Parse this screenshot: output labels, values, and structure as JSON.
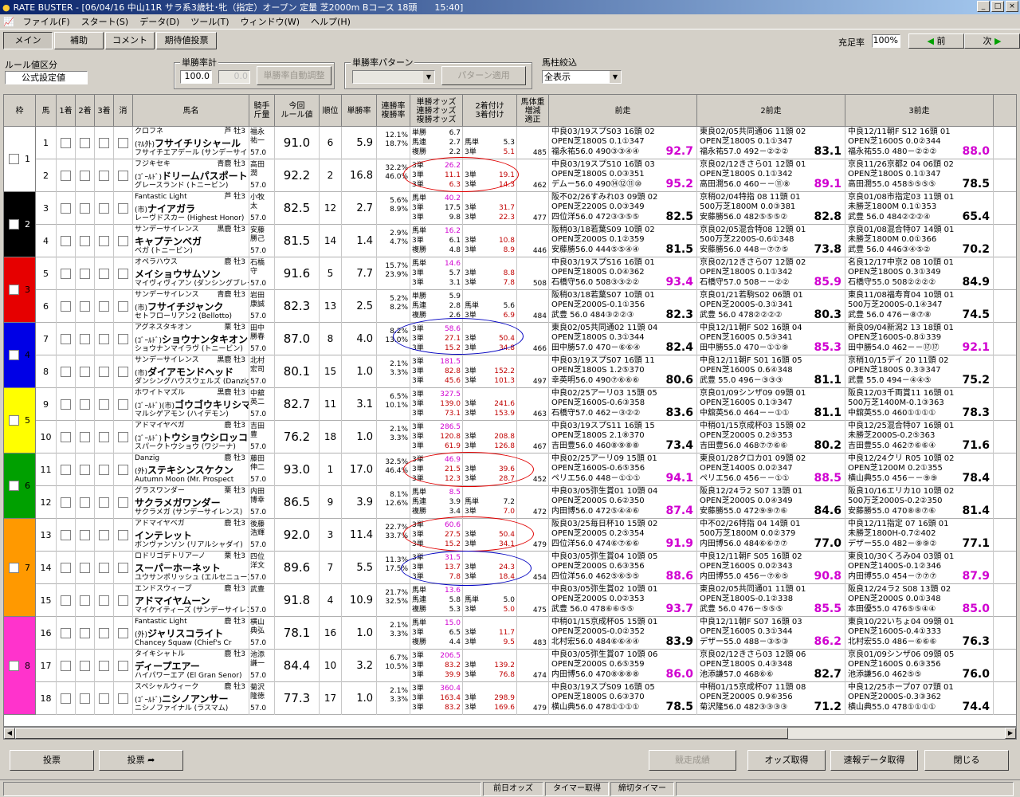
{
  "window": {
    "title": "RATE BUSTER - [06/04/16 中山11R サラ系3歳牡･牝（指定）オープン 定量 芝2000m Bコース 18頭　　15:40]"
  },
  "menu": [
    "ファイル(F)",
    "スタート(S)",
    "データ(D)",
    "ツール(T)",
    "ウィンドウ(W)",
    "ヘルプ(H)"
  ],
  "tabs": [
    "メイン",
    "補助",
    "コメント",
    "期待値投票"
  ],
  "fill_rate": {
    "label": "充足率",
    "value": "100%"
  },
  "nav": {
    "prev": "前",
    "next": "次"
  },
  "rule": {
    "label": "ルール値区分",
    "value": "公式設定値"
  },
  "win_rate": {
    "label": "単勝率計",
    "value1": "100.0",
    "value2": "0.0",
    "button": "単勝率自動調整"
  },
  "pattern": {
    "label": "単勝率パターン",
    "button": "パターン適用"
  },
  "filter": {
    "label": "馬柱絞込",
    "value": "全表示"
  },
  "headers": {
    "waku": "枠",
    "uma": "馬",
    "p1": "1着",
    "p2": "2着",
    "p3": "3着",
    "scratch": "消",
    "name": "馬名",
    "jockey": "騎手\n斤量",
    "rule_val": "今回\nルール値",
    "rank": "順位",
    "win": "単勝率",
    "ren": "連勝率\n複勝率",
    "odds": "単勝オッズ\n連勝オッズ\n複勝オッズ",
    "place2": "2着付け\n3着付け",
    "weight": "馬体重\n増減\n適正",
    "prev1": "前走",
    "prev2": "2前走",
    "prev3": "3前走"
  },
  "colors": {
    "waku": [
      "#ffffff",
      "#000000",
      "#e60000",
      "#0000e6",
      "#ffff00",
      "#00a000",
      "#ff9900",
      "#ff33cc"
    ]
  },
  "horses": [
    {
      "num": "1",
      "sire": "クロフネ",
      "tag": "芦 牡3",
      "pre": "(ﾏﾙ外)",
      "name": "フサイチリシャール",
      "dam": "フサイチエアデール (サンデーサイレンス)",
      "jockey": "福永\n祐一",
      "kg": "57.0",
      "rv": "91.0",
      "rank": "6",
      "win": "5.9",
      "ren": "12.1%\n18.7%",
      "o1": "単勝",
      "v1": "6.7",
      "o2": "馬連",
      "v2": "2.7",
      "o3": "複勝",
      "v3": "2.2",
      "p2": "",
      "q2": "",
      "p3": "馬単",
      "q3": "5.3",
      "p4": "3単",
      "q4": "5.1",
      "wt": "485",
      "r1": "中良03/19スプS03 16頭 02",
      "r1b": "OPEN芝1800S 0.1①347",
      "r1c": "福永祐56.0 490③③④④",
      "r1s": "92.7",
      "r2": "東良02/05共同通06 11頭 02",
      "r2b": "OPEN芝1800S 0.1①347",
      "r2c": "福永祐57.0 492－②②②",
      "r2s": "83.1",
      "r3": "中良12/11朝F S12 16頭 01",
      "r3b": "OPEN芝1600S 0.0②344",
      "r3c": "福永祐55.0 480－②②②",
      "r3s": "88.0"
    },
    {
      "num": "2",
      "sire": "フジキセキ",
      "tag": "青鹿 牡3",
      "pre": "(ｺﾞｰﾙﾄﾞ)",
      "name": "ドリームパスポート",
      "dam": "グレースランド (トニービン)",
      "jockey": "高田\n潤",
      "kg": "57.0",
      "rv": "92.2",
      "rank": "2",
      "win": "16.8",
      "ren": "32.2%\n46.0%",
      "o1": "3単",
      "v1": "26.2",
      "o2": "3単",
      "v2": "11.1",
      "o3": "3単",
      "v3": "6.3",
      "p2": "",
      "q2": "",
      "p3": "3単",
      "q3": "19.1",
      "p4": "3単",
      "q4": "14.3",
      "wt": "462",
      "r1": "中良03/19スプS10 16頭 03",
      "r1b": "OPEN芝1800S 0.0③351",
      "r1c": "デムー56.0 490⑭⑫⑪⑩",
      "r1s": "95.2",
      "r2": "京良02/12きさら01 12頭 01",
      "r2b": "OPEN芝1800S 0.1①342",
      "r2c": "高田潤56.0 460－－⑪⑧",
      "r2s": "89.1",
      "r3": "京良11/26京都2 04 06頭 02",
      "r3b": "OPEN芝1800S 0.1①347",
      "r3c": "高田潤55.0 458⑤⑤⑤⑤",
      "r3s": "78.5"
    },
    {
      "num": "3",
      "sire": "Fantastic Light",
      "tag": "芦 牡3",
      "pre": "(市)",
      "name": "ナイアガラ",
      "dam": "レーヴドスカー (Highest Honor)",
      "jockey": "小牧\n太",
      "kg": "57.0",
      "rv": "82.5",
      "rank": "12",
      "win": "2.7",
      "ren": "5.6%\n8.9%",
      "o1": "馬単",
      "v1": "40.2",
      "o2": "3単",
      "v2": "17.5",
      "o3": "3単",
      "v3": "9.8",
      "p2": "",
      "q2": "",
      "p3": "3単",
      "q3": "31.7",
      "p4": "3単",
      "q4": "22.3",
      "wt": "477",
      "r1": "阪不02/26すみれ03 09頭 02",
      "r1b": "OPEN芝2200S 0.0③349",
      "r1c": "四位洋56.0 472③③⑤⑤",
      "r1s": "82.5",
      "r2": "京稍02/04特指 08 11頭 01",
      "r2b": "500万芝1800M 0.0③381",
      "r2c": "安藤勝56.0 482⑤⑤⑤②",
      "r2s": "82.8",
      "r3": "京良01/08市指定03 11頭 01",
      "r3b": "未勝芝1800M 0.1①353",
      "r3c": "武豊 56.0 484②②②④",
      "r3s": "65.4"
    },
    {
      "num": "4",
      "sire": "サンデーサイレンス",
      "tag": "黒鹿 牡3",
      "pre": "",
      "name": "キャプテンベガ",
      "dam": "ベガ (トニービン)",
      "jockey": "安藤\n勝己",
      "kg": "57.0",
      "rv": "81.5",
      "rank": "14",
      "win": "1.4",
      "ren": "2.9%\n4.7%",
      "o1": "馬単",
      "v1": "16.2",
      "o2": "3単",
      "v2": "6.1",
      "o3": "複勝",
      "v3": "4.8",
      "p2": "",
      "q2": "",
      "p3": "3単",
      "q3": "10.8",
      "p4": "3単",
      "q4": "8.9",
      "wt": "446",
      "r1": "阪稍03/18若葉S09 10頭 02",
      "r1b": "OPEN芝2000S 0.1②359",
      "r1c": "安藤勝56.0 444⑤⑤④④",
      "r1s": "81.5",
      "r2": "京良02/05混合特08 12頭 01",
      "r2b": "500万芝2200S-0.6①348",
      "r2c": "安藤勝56.0 448－⑦⑦⑤",
      "r2s": "73.8",
      "r3": "京良01/08混合特07 14頭 01",
      "r3b": "未勝芝1800M 0.0①366",
      "r3c": "武豊 56.0 446③④⑤②",
      "r3s": "70.2"
    },
    {
      "num": "5",
      "sire": "オペラハウス",
      "tag": "鹿 牡3",
      "pre": "",
      "name": "メイショウサムソン",
      "dam": "マイヴィヴィアン (ダンシングブレーヴ)",
      "jockey": "石橋\n守",
      "kg": "57.0",
      "rv": "91.6",
      "rank": "5",
      "win": "7.7",
      "ren": "15.7%\n23.9%",
      "o1": "馬単",
      "v1": "14.6",
      "o2": "3単",
      "v2": "5.7",
      "o3": "3単",
      "v3": "3.1",
      "p2": "",
      "q2": "",
      "p3": "3単",
      "q3": "8.8",
      "p4": "3単",
      "q4": "7.8",
      "wt": "508",
      "r1": "中良03/19スプS16 16頭 01",
      "r1b": "OPEN芝1800S 0.0④362",
      "r1c": "石橋守56.0 508③③②②",
      "r1s": "93.4",
      "r2": "京良02/12きさら07 12頭 02",
      "r2b": "OPEN芝1800S 0.1①342",
      "r2c": "石橋守57.0 508－－②②",
      "r2s": "85.9",
      "r3": "名良12/17中京2 08 10頭 01",
      "r3b": "OPEN芝1800S 0.3①349",
      "r3c": "石橋守55.0 508②②②②",
      "r3s": "84.9"
    },
    {
      "num": "6",
      "sire": "サンデーサイレンス",
      "tag": "青鹿 牡3",
      "pre": "(市)",
      "name": "フサイチジャンク",
      "dam": "セトフローリアン2 (Bellotto)",
      "jockey": "岩田\n康誠",
      "kg": "57.0",
      "rv": "82.3",
      "rank": "13",
      "win": "2.5",
      "ren": "5.2%\n8.2%",
      "o1": "単勝",
      "v1": "5.9",
      "o2": "馬連",
      "v2": "2.8",
      "o3": "複勝",
      "v3": "2.6",
      "p2": "",
      "q2": "",
      "p3": "馬単",
      "q3": "5.6",
      "p4": "3単",
      "q4": "6.9",
      "wt": "484",
      "r1": "阪稍03/18若葉S07 10頭 01",
      "r1b": "OPEN芝2000S-0.1①356",
      "r1c": "武豊 56.0 484③②②③",
      "r1s": "82.3",
      "r2": "京良01/21若駒S02 06頭 01",
      "r2b": "OPEN芝2000S-0.3①341",
      "r2c": "武豊 56.0 478②②②②",
      "r2s": "80.3",
      "r3": "東良11/08福寿育04 10頭 01",
      "r3b": "500万芝2000S-0.1④347",
      "r3c": "武豊 56.0 476－⑧⑦⑧",
      "r3s": "74.5"
    },
    {
      "num": "7",
      "sire": "アグネスタキオン",
      "tag": "栗 牡3",
      "pre": "(ｺﾞｰﾙﾄﾞ)",
      "name": "ショウナンタキオン",
      "dam": "ショウナンマイラヴ (トニービン)",
      "jockey": "田中\n勝春",
      "kg": "57.0",
      "rv": "87.0",
      "rank": "8",
      "win": "4.0",
      "ren": "8.2%\n13.0%",
      "o1": "3単",
      "v1": "58.6",
      "o2": "3単",
      "v2": "27.1",
      "o3": "3単",
      "v3": "15.2",
      "p2": "",
      "q2": "",
      "p3": "3単",
      "q3": "50.4",
      "p4": "3単",
      "q4": "34.8",
      "wt": "466",
      "r1": "東良02/05共同通02 11頭 04",
      "r1b": "OPEN芝1800S 0.3①344",
      "r1c": "田中勝57.0 470－⑥⑥④",
      "r1s": "82.4",
      "r2": "中良12/11朝F S02 16頭 04",
      "r2b": "OPEN芝1600S 0.5③341",
      "r2c": "田中勝55.0 470－①①⑨",
      "r2s": "85.3",
      "r3": "新良09/04新潟2 13 18頭 01",
      "r3b": "OPEN芝1600S-0.8①339",
      "r3c": "田中勝54.0 462－－⑰⑰",
      "r3s": "92.1"
    },
    {
      "num": "8",
      "sire": "サンデーサイレンス",
      "tag": "黒鹿 牡3",
      "pre": "(市)",
      "name": "ダイアモンドヘッド",
      "dam": "ダンシングハウスウェルズ (Danzig)",
      "jockey": "北村\n宏司",
      "kg": "57.0",
      "rv": "80.1",
      "rank": "15",
      "win": "1.0",
      "ren": "2.1%\n3.3%",
      "o1": "3単",
      "v1": "181.5",
      "o2": "3単",
      "v2": "82.8",
      "o3": "3単",
      "v3": "45.6",
      "p2": "",
      "q2": "",
      "p3": "3単",
      "q3": "152.2",
      "p4": "3単",
      "q4": "101.3",
      "wt": "497",
      "r1": "中良03/19スプS07 16頭 11",
      "r1b": "OPEN芝1800S 1.2⑤370",
      "r1c": "幸英明56.0 490⑦⑥⑥⑥",
      "r1s": "80.6",
      "r2": "中良12/11朝F S01 16頭 05",
      "r2b": "OPEN芝1600S 0.6④348",
      "r2c": "武豊 55.0 496－③③③",
      "r2s": "81.1",
      "r3": "京稍10/15デイ 20 11頭 02",
      "r3b": "OPEN芝1800S 0.3③347",
      "r3c": "武豊 55.0 494－④④⑤",
      "r3s": "75.2"
    },
    {
      "num": "9",
      "sire": "ホワイトマズル",
      "tag": "黒鹿 牡3",
      "pre": "(ｺﾞｰﾙﾄﾞ)(市)",
      "name": "ゴウゴウキリシマ",
      "dam": "マルシゲアモン (ハイデモン)",
      "jockey": "中舘\n英二",
      "kg": "57.0",
      "rv": "82.7",
      "rank": "11",
      "win": "3.1",
      "ren": "6.5%\n10.1%",
      "o1": "3単",
      "v1": "327.5",
      "o2": "3単",
      "v2": "139.0",
      "o3": "3単",
      "v3": "73.1",
      "p2": "",
      "q2": "",
      "p3": "3単",
      "q3": "241.6",
      "p4": "3単",
      "q4": "153.9",
      "wt": "463",
      "r1": "中良02/25アーリ03 15頭 05",
      "r1b": "OPEN芝1600S-0.6③358",
      "r1c": "石橋守57.0 462－③②②",
      "r1s": "83.6",
      "r2": "京良01/09シンザ09 09頭 01",
      "r2b": "OPEN芝1600S 0.1③347",
      "r2c": "中舘英56.0 464－－①①",
      "r2s": "81.1",
      "r3": "阪良12/03千両賞11 16頭 01",
      "r3b": "500万芝1400M-0.1③363",
      "r3c": "中舘英55.0 460①①①①",
      "r3s": "78.3"
    },
    {
      "num": "10",
      "sire": "アドマイヤベガ",
      "tag": "鹿 牡3",
      "pre": "(ｺﾞｰﾙﾄﾞ)",
      "name": "トウショウシロッコ",
      "dam": "スパークトウショウ (ワジーナ)",
      "jockey": "吉田\n豊",
      "kg": "57.0",
      "rv": "76.2",
      "rank": "18",
      "win": "1.0",
      "ren": "2.1%\n3.3%",
      "o1": "3単",
      "v1": "286.5",
      "o2": "3単",
      "v2": "120.8",
      "o3": "3単",
      "v3": "61.9",
      "p2": "",
      "q2": "",
      "p3": "3単",
      "q3": "208.8",
      "p4": "3単",
      "q4": "126.8",
      "wt": "467",
      "r1": "中良03/19スプS11 16頭 15",
      "r1b": "OPEN芝1800S 2.1⑧370",
      "r1c": "吉田豊56.0 460⑧⑨⑧⑧",
      "r1s": "73.4",
      "r2": "中稍01/15京成杯03 15頭 02",
      "r2b": "OPEN芝2000S 0.2⑤353",
      "r2c": "吉田豊56.0 468⑦⑦⑥⑥",
      "r2s": "80.2",
      "r3": "中良12/25混合特07 16頭 01",
      "r3b": "未勝芝2000S-0.2⑤363",
      "r3c": "吉田豊55.0 462⑦⑥⑥④",
      "r3s": "71.6"
    },
    {
      "num": "11",
      "sire": "Danzig",
      "tag": "鹿 牡3",
      "pre": "(外)",
      "name": "ステキシンスケクン",
      "dam": "Autumn Moon (Mr. Prospect",
      "jockey": "藤田\n伸二",
      "kg": "57.0",
      "rv": "93.0",
      "rank": "1",
      "win": "17.0",
      "ren": "32.5%\n46.4%",
      "o1": "3単",
      "v1": "46.9",
      "o2": "3単",
      "v2": "21.5",
      "o3": "3単",
      "v3": "12.3",
      "p2": "",
      "q2": "",
      "p3": "3単",
      "q3": "39.6",
      "p4": "3単",
      "q4": "28.7",
      "wt": "452",
      "r1": "中良02/25アーリ09 15頭 01",
      "r1b": "OPEN芝1600S-0.6⑤356",
      "r1c": "ペリエ56.0 448－①①①",
      "r1s": "94.1",
      "r2": "東良01/28クロカ01 09頭 02",
      "r2b": "OPEN芝1400S 0.0②347",
      "r2c": "ペリエ56.0 456－－①①",
      "r2s": "88.5",
      "r3": "中良12/24クリ R05 10頭 02",
      "r3b": "OPEN芝1200M 0.2①355",
      "r3c": "横山典55.0 456－－⑨⑨",
      "r3s": "78.4"
    },
    {
      "num": "12",
      "sire": "グラスワンダー",
      "tag": "栗 牡3",
      "pre": "",
      "name": "サクラメガワンダー",
      "dam": "サクラメガ (サンデーサイレンス)",
      "jockey": "内田\n博幸",
      "kg": "57.0",
      "rv": "86.5",
      "rank": "9",
      "win": "3.9",
      "ren": "8.1%\n12.6%",
      "o1": "馬単",
      "v1": "8.5",
      "o2": "馬連",
      "v2": "3.9",
      "o3": "複勝",
      "v3": "3.4",
      "p2": "",
      "q2": "",
      "p3": "馬単",
      "q3": "7.2",
      "p4": "3単",
      "q4": "7.0",
      "wt": "472",
      "r1": "中良03/05弥生賞01 10頭 04",
      "r1b": "OPEN芝2000S 0.6②350",
      "r1c": "内田博56.0 472⑤④④⑥",
      "r1s": "87.4",
      "r2": "阪良12/24ラ2 S07 13頭 01",
      "r2b": "OPEN芝2000S 0.0④349",
      "r2c": "安藤勝55.0 472⑨⑨⑦⑥",
      "r2s": "84.6",
      "r3": "阪良10/16エリカ10 10頭 02",
      "r3b": "500万芝2000S-0.2②350",
      "r3c": "安藤勝55.0 470⑧⑧⑦⑥",
      "r3s": "81.4"
    },
    {
      "num": "13",
      "sire": "アドマイヤベガ",
      "tag": "鹿 牡3",
      "pre": "",
      "name": "インテレット",
      "dam": "ボンヴァンソン (リアルシャダイ)",
      "jockey": "後藤\n浩輝",
      "kg": "57.0",
      "rv": "92.0",
      "rank": "3",
      "win": "11.4",
      "ren": "22.7%\n33.7%",
      "o1": "3単",
      "v1": "60.6",
      "o2": "3単",
      "v2": "27.5",
      "o3": "3単",
      "v3": "15.2",
      "p2": "",
      "q2": "",
      "p3": "3単",
      "q3": "50.4",
      "p4": "3単",
      "q4": "34.1",
      "wt": "479",
      "r1": "阪良03/25毎日杯10 15頭 02",
      "r1b": "OPEN芝2000S 0.2⑤354",
      "r1c": "四位洋56.0 474⑥⑦⑥⑥",
      "r1s": "91.9",
      "r2": "中不02/26特指 04 14頭 01",
      "r2b": "500万芝1800M 0.0②379",
      "r2c": "内田博56.0 484⑥⑥⑦⑦",
      "r2s": "77.0",
      "r3": "中良12/11指定 07 16頭 01",
      "r3b": "未勝芝1800H-0.7②402",
      "r3c": "デザー55.0 482－⑨⑨②",
      "r3s": "77.1"
    },
    {
      "num": "14",
      "sire": "ロドリゴデトリアーノ",
      "tag": "栗 牡3",
      "pre": "",
      "name": "スーパーホーネット",
      "dam": "ユウサンポリッシュ (エルセニュー)",
      "jockey": "四位\n洋文",
      "kg": "57.0",
      "rv": "89.6",
      "rank": "7",
      "win": "5.5",
      "ren": "11.3%\n17.5%",
      "o1": "3単",
      "v1": "31.5",
      "o2": "3単",
      "v2": "13.7",
      "o3": "3単",
      "v3": "7.8",
      "p2": "",
      "q2": "",
      "p3": "3単",
      "q3": "24.3",
      "p4": "3単",
      "q4": "18.4",
      "wt": "454",
      "r1": "中良03/05弥生賞04 10頭 05",
      "r1b": "OPEN芝2000S 0.6③356",
      "r1c": "四位洋56.0 462⑤⑥⑤⑤",
      "r1s": "88.6",
      "r2": "中良12/11朝F S05 16頭 02",
      "r2b": "OPEN芝1600S 0.0②343",
      "r2c": "内田博55.0 456－⑦⑥⑤",
      "r2s": "90.8",
      "r3": "東良10/30くろみ04 03頭 01",
      "r3b": "OPEN芝1400S-0.1②346",
      "r3c": "内田博55.0 454－⑦⑦⑦",
      "r3s": "87.9"
    },
    {
      "num": "15",
      "sire": "エンドスウィープ",
      "tag": "鹿 牡3",
      "pre": "",
      "name": "アドマイヤムーン",
      "dam": "マイケイティーズ (サンデーサイレンス)",
      "jockey": "武豊",
      "kg": "57.0",
      "rv": "91.8",
      "rank": "4",
      "win": "10.9",
      "ren": "21.7%\n32.5%",
      "o1": "馬単",
      "v1": "13.6",
      "o2": "馬連",
      "v2": "5.8",
      "o3": "複勝",
      "v3": "5.3",
      "p2": "",
      "q2": "",
      "p3": "馬単",
      "q3": "5.0",
      "p4": "3単",
      "q4": "5.0",
      "wt": "475",
      "r1": "中良03/05弥生賞02 10頭 01",
      "r1b": "OPEN芝2000S 0.0②353",
      "r1c": "武豊 56.0 478⑥⑥⑤⑤",
      "r1s": "93.7",
      "r2": "東良02/05共同通01 11頭 01",
      "r2b": "OPEN芝1800S-0.1②338",
      "r2c": "武豊 56.0 476－⑤⑤⑤",
      "r2s": "85.5",
      "r3": "阪良12/24ラ2 S08 13頭 02",
      "r3b": "OPEN芝2000S 0.0①348",
      "r3c": "本田優55.0 476⑤⑤④④",
      "r3s": "85.0"
    },
    {
      "num": "16",
      "sire": "Fantastic Light",
      "tag": "鹿 牡3",
      "pre": "(外)",
      "name": "ジャリスコライト",
      "dam": "Chancey Squaw (Chief's Cr",
      "jockey": "横山\n典弘",
      "kg": "57.0",
      "rv": "78.1",
      "rank": "16",
      "win": "1.0",
      "ren": "2.1%\n3.3%",
      "o1": "馬単",
      "v1": "15.0",
      "o2": "3単",
      "v2": "6.5",
      "o3": "複勝",
      "v3": "4.4",
      "p2": "",
      "q2": "",
      "p3": "3単",
      "q3": "11.7",
      "p4": "3単",
      "q4": "9.5",
      "wt": "483",
      "r1": "中稍01/15京成杯05 15頭 01",
      "r1b": "OPEN芝2000S-0.0②352",
      "r1c": "北村宏56.0 484⑥⑥④④",
      "r1s": "83.9",
      "r2": "中良12/11朝F S07 16頭 03",
      "r2b": "OPEN芝1600S 0.3①344",
      "r2c": "デザー55.0 488－③⑤③",
      "r2s": "86.2",
      "r3": "東良10/22いちょ04 09頭 01",
      "r3b": "OPEN芝1600S-0.4①333",
      "r3c": "北村宏55.0 486－⑥⑥⑥",
      "r3s": "76.3"
    },
    {
      "num": "17",
      "sire": "タイキシャトル",
      "tag": "鹿 牡3",
      "pre": "",
      "name": "ディープエアー",
      "dam": "ハイパワーエア (El Gran Senor)",
      "jockey": "池添\n謙一",
      "kg": "57.0",
      "rv": "84.4",
      "rank": "10",
      "win": "3.2",
      "ren": "6.7%\n10.5%",
      "o1": "3単",
      "v1": "206.5",
      "o2": "3単",
      "v2": "83.2",
      "o3": "3単",
      "v3": "39.9",
      "p2": "",
      "q2": "",
      "p3": "3単",
      "q3": "139.2",
      "p4": "3単",
      "q4": "76.8",
      "wt": "474",
      "r1": "中良03/05弥生賞07 10頭 06",
      "r1b": "OPEN芝2000S 0.6⑤359",
      "r1c": "内田博56.0 470⑧⑧⑧⑧",
      "r1s": "86.0",
      "r2": "京良02/12きさら03 12頭 06",
      "r2b": "OPEN芝1800S 0.4③348",
      "r2c": "池添謙57.0 468⑥⑥",
      "r2s": "82.7",
      "r3": "京良01/09シンザ06 09頭 05",
      "r3b": "OPEN芝1600S 0.6③356",
      "r3c": "池添謙56.0 462⑤⑤",
      "r3s": "76.0"
    },
    {
      "num": "18",
      "sire": "スペシャルウィーク",
      "tag": "鹿 牡3",
      "pre": "(ｺﾞｰﾙﾄﾞ)",
      "name": "ニシノアンサー",
      "dam": "ニシノファイナル (ラスマム)",
      "jockey": "菊沢\n隆徳",
      "kg": "57.0",
      "rv": "77.3",
      "rank": "17",
      "win": "1.0",
      "ren": "2.1%\n3.3%",
      "o1": "3単",
      "v1": "360.4",
      "o2": "3単",
      "v2": "163.4",
      "o3": "3単",
      "v3": "83.2",
      "p2": "",
      "q2": "",
      "p3": "3単",
      "q3": "298.9",
      "p4": "3単",
      "q4": "169.6",
      "wt": "479",
      "r1": "中良03/19スプS09 16頭 05",
      "r1b": "OPEN芝1800S 0.6③370",
      "r1c": "横山典56.0 478①①①①",
      "r1s": "78.5",
      "r2": "中稍01/15京成杯07 11頭 08",
      "r2b": "OPEN芝2000S 0.9⑥356",
      "r2c": "菊沢隆56.0 482③③③③",
      "r2s": "71.2",
      "r3": "中良12/25ホープ07 07頭 01",
      "r3b": "OPEN芝2000S-0.3③362",
      "r3c": "横山典55.0 478①①①①",
      "r3s": "74.4"
    }
  ],
  "bottom": {
    "vote": "投票",
    "vote2": "投票 ➦",
    "hist": "競走成績",
    "odds": "オッズ取得",
    "data": "速報データ取得",
    "close": "閉じる"
  },
  "status": {
    "prev_odds": "前日オッズ",
    "timer": "タイマー取得",
    "deadline": "締切タイマー"
  }
}
